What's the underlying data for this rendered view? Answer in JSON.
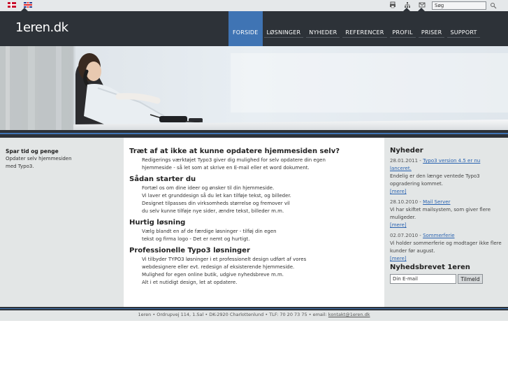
{
  "topbar": {
    "flag_dk": "Danish flag",
    "flag_uk": "English flag",
    "icons": [
      "print-icon",
      "sitemap-icon",
      "mail-icon"
    ],
    "search_value": "Søg"
  },
  "header": {
    "logo": "1eren.dk",
    "nav": [
      {
        "label": "FORSIDE",
        "active": true
      },
      {
        "label": "LØSNINGER",
        "active": false
      },
      {
        "label": "NYHEDER",
        "active": false
      },
      {
        "label": "REFERENCER",
        "active": false
      },
      {
        "label": "PROFIL",
        "active": false
      },
      {
        "label": "PRISER",
        "active": false
      },
      {
        "label": "SUPPORT",
        "active": false
      }
    ]
  },
  "left": {
    "title": "Spar tid og penge",
    "text": "Opdater selv hjemmesiden med Typo3."
  },
  "main": {
    "sections": [
      {
        "title": "Træt af at ikke at kunne opdatere hjemmesiden selv?",
        "lines": [
          "Redigerings værktøjet Typo3 giver dig mulighed for selv opdatere din egen",
          "hjemmeside - så let som at skrive en E-mail eller et word dokument."
        ]
      },
      {
        "title": "Sådan starter du",
        "lines": [
          "Fortæl os om dine ideer og ønsker til din hjemmeside.",
          "Vi laver et grunddesign så du let kan tilføje tekst, og billeder.",
          "Designet tilpasses din virksomheds størrelse og fremover vil",
          "du selv kunne tilføje nye sider, ændre tekst, billeder m.m."
        ]
      },
      {
        "title": "Hurtig løsning",
        "lines": [
          "Vælg blandt en af de færdige løsninger - tilføj din egen",
          "tekst og firma logo - Det er nemt og hurtigt."
        ]
      },
      {
        "title": "Professionelle Typo3 løsninger",
        "lines": [
          "Vi tilbyder TYPO3 løsninger i et professionelt design udført af vores",
          "webdesignere eller evt. redesign af eksisterende hjemmeside.",
          "Mulighed for egen online butik, udgive nyhedsbreve m.m.",
          "Alt i et nutidigt design, let at opdatere."
        ]
      }
    ]
  },
  "right": {
    "news_title": "Nyheder",
    "news": [
      {
        "date": "28.01.2011 -",
        "link": "Typo3 version 4.5 er nu lanceret.",
        "text": "Endelig er den længe ventede Typo3 opgradering kommet.",
        "more": "[mere]"
      },
      {
        "date": "28.10.2010 -",
        "link": "Mail Server",
        "text": "Vi har skiftet mailsystem, som giver flere muligeder.",
        "more": "[mere]"
      },
      {
        "date": "02.07.2010 -",
        "link": "Sommerferie",
        "text": "Vi holder sommerferie og modtager ikke flere kunder før august.",
        "more": "[mere]"
      }
    ],
    "newsletter_title": "Nyhedsbrevet 1eren",
    "email_value": "Din E-mail",
    "subscribe_label": "Tilmeld"
  },
  "footer": {
    "text": "1eren • Ordrupvej 114, 1.Sal • DK-2920 Charlottenlund • TLF: 70 20 73 75 • email:",
    "email": "kontakt@1eren.dk"
  },
  "colors": {
    "header_bg": "#2d3238",
    "accent": "#3f74b4",
    "side_bg": "#e3e6e6",
    "link": "#2a63b0"
  }
}
